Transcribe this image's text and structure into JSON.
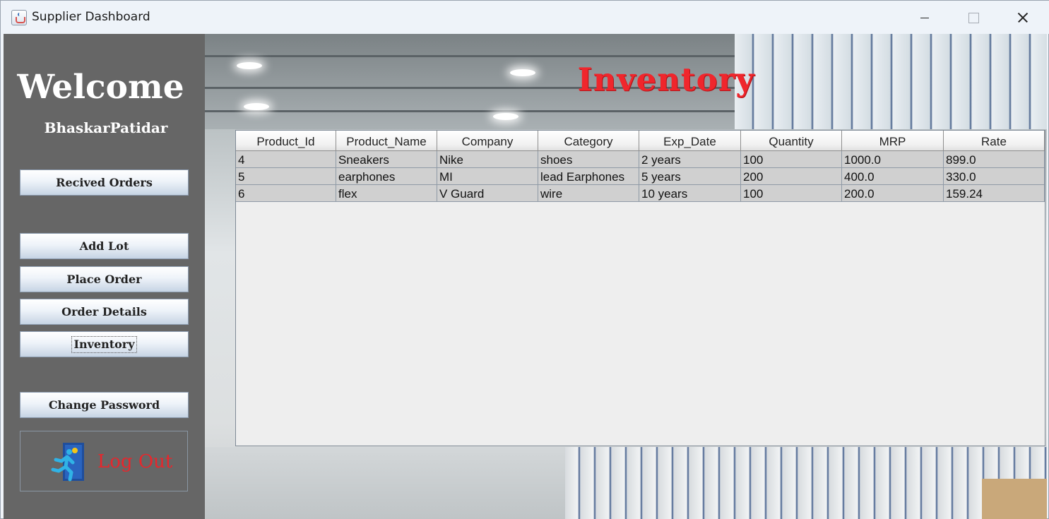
{
  "window": {
    "title": "Supplier Dashboard"
  },
  "sidebar": {
    "welcome": "Welcome",
    "username": "BhaskarPatidar",
    "buttons": [
      {
        "label": "Recived Orders"
      },
      {
        "label": "Add Lot"
      },
      {
        "label": "Place Order"
      },
      {
        "label": "Order Details"
      },
      {
        "label": "Inventory"
      },
      {
        "label": "Change Password"
      }
    ],
    "logout": {
      "label": "Log Out",
      "icon": "exit-door-icon"
    }
  },
  "main": {
    "heading": "Inventory",
    "table": {
      "columns": [
        "Product_Id",
        "Product_Name",
        "Company",
        "Category",
        "Exp_Date",
        "Quantity",
        "MRP",
        "Rate"
      ],
      "rows": [
        [
          "4",
          "Sneakers",
          "Nike",
          "shoes",
          "2 years",
          "100",
          "1000.0",
          "899.0"
        ],
        [
          "5",
          "earphones",
          "MI",
          "lead Earphones",
          "5 years",
          "200",
          "400.0",
          "330.0"
        ],
        [
          "6",
          "flex",
          "V Guard",
          "wire",
          "10 years",
          "100",
          "200.0",
          "159.24"
        ]
      ]
    }
  },
  "colors": {
    "sidebar": "#666666",
    "heading": "#f0262c",
    "logout": "#e8262c",
    "row_bg": "#d0d0d0"
  }
}
